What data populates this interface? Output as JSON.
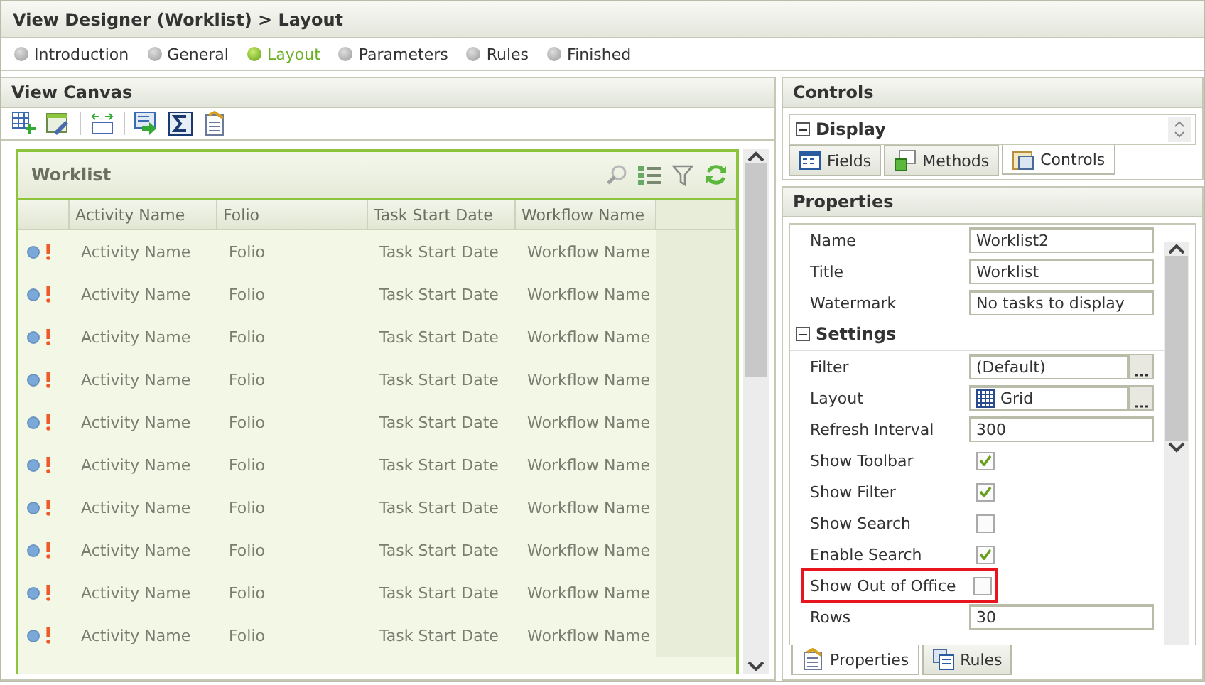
{
  "window": {
    "title": "View Designer (Worklist) > Layout"
  },
  "steps": [
    {
      "label": "Introduction",
      "selected": false
    },
    {
      "label": "General",
      "selected": false
    },
    {
      "label": "Layout",
      "selected": true
    },
    {
      "label": "Parameters",
      "selected": false
    },
    {
      "label": "Rules",
      "selected": false
    },
    {
      "label": "Finished",
      "selected": false
    }
  ],
  "canvas": {
    "title": "View Canvas",
    "worklist": {
      "title": "Worklist",
      "columns": [
        "Activity Name",
        "Folio",
        "Task Start Date",
        "Workflow Name"
      ],
      "rows": [
        [
          "Activity Name",
          "Folio",
          "Task Start Date",
          "Workflow Name"
        ],
        [
          "Activity Name",
          "Folio",
          "Task Start Date",
          "Workflow Name"
        ],
        [
          "Activity Name",
          "Folio",
          "Task Start Date",
          "Workflow Name"
        ],
        [
          "Activity Name",
          "Folio",
          "Task Start Date",
          "Workflow Name"
        ],
        [
          "Activity Name",
          "Folio",
          "Task Start Date",
          "Workflow Name"
        ],
        [
          "Activity Name",
          "Folio",
          "Task Start Date",
          "Workflow Name"
        ],
        [
          "Activity Name",
          "Folio",
          "Task Start Date",
          "Workflow Name"
        ],
        [
          "Activity Name",
          "Folio",
          "Task Start Date",
          "Workflow Name"
        ],
        [
          "Activity Name",
          "Folio",
          "Task Start Date",
          "Workflow Name"
        ],
        [
          "Activity Name",
          "Folio",
          "Task Start Date",
          "Workflow Name"
        ]
      ]
    }
  },
  "controls": {
    "title": "Controls",
    "group": "Display",
    "expanded": true,
    "tabs": [
      {
        "label": "Fields",
        "selected": false
      },
      {
        "label": "Methods",
        "selected": false
      },
      {
        "label": "Controls",
        "selected": true
      }
    ]
  },
  "properties": {
    "title": "Properties",
    "items": [
      {
        "kind": "text",
        "label": "Name",
        "value": "Worklist2"
      },
      {
        "kind": "text",
        "label": "Title",
        "value": "Worklist"
      },
      {
        "kind": "text",
        "label": "Watermark",
        "value": "No tasks to display"
      },
      {
        "kind": "section",
        "label": "Settings",
        "expanded": true
      },
      {
        "kind": "picker",
        "label": "Filter",
        "value": "(Default)"
      },
      {
        "kind": "gridpicker",
        "label": "Layout",
        "value": "Grid"
      },
      {
        "kind": "text",
        "label": "Refresh Interval",
        "value": "300"
      },
      {
        "kind": "checkbox",
        "label": "Show Toolbar",
        "checked": true,
        "highlighted": false
      },
      {
        "kind": "checkbox",
        "label": "Show Filter",
        "checked": true,
        "highlighted": false
      },
      {
        "kind": "checkbox",
        "label": "Show Search",
        "checked": false,
        "highlighted": false
      },
      {
        "kind": "checkbox",
        "label": "Enable Search",
        "checked": true,
        "highlighted": false
      },
      {
        "kind": "checkbox",
        "label": "Show Out of Office",
        "checked": false,
        "highlighted": true
      },
      {
        "kind": "text",
        "label": "Rows",
        "value": "30"
      }
    ],
    "tabs": [
      {
        "label": "Properties",
        "selected": true
      },
      {
        "label": "Rules",
        "selected": false
      }
    ]
  }
}
